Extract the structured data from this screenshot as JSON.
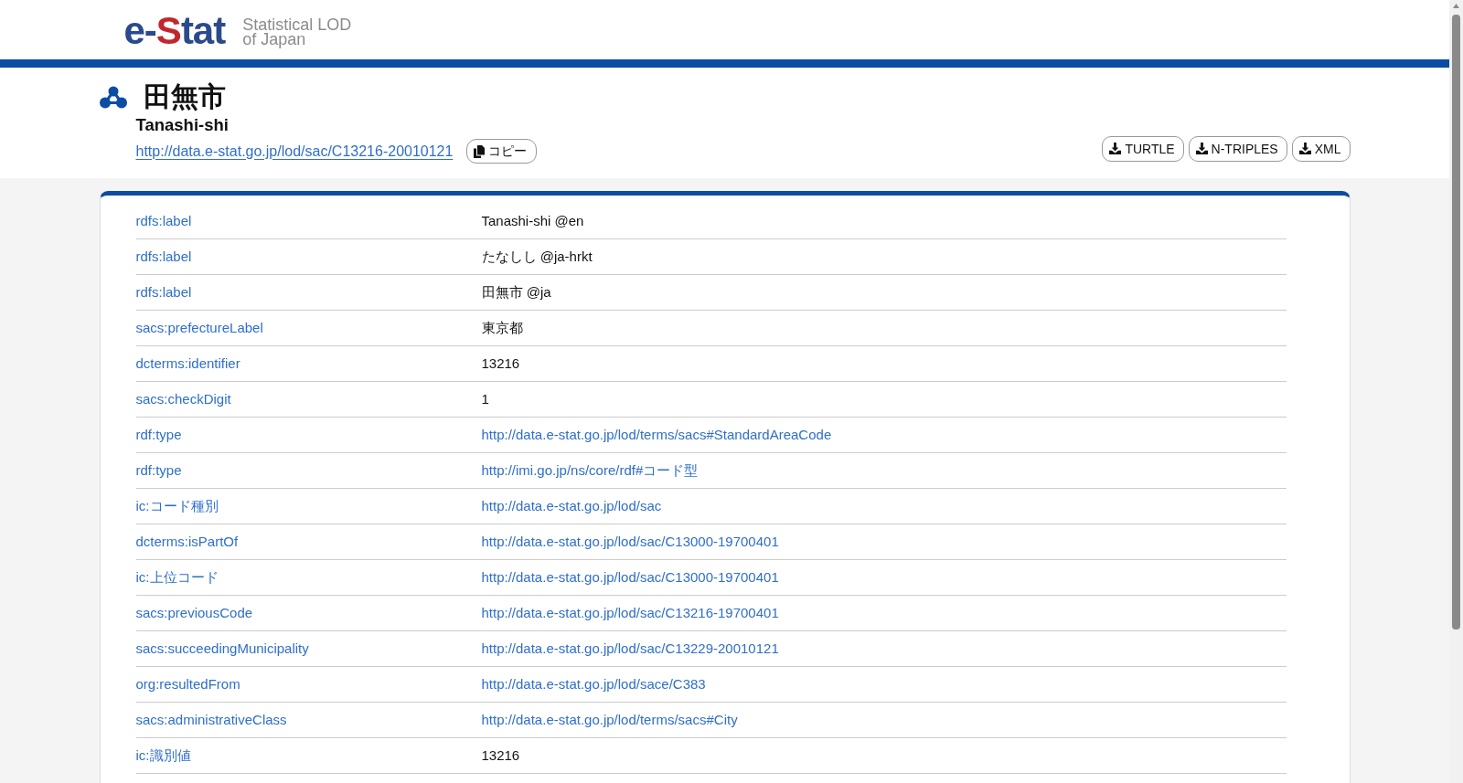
{
  "header": {
    "logo": {
      "parts": [
        {
          "text": "e-",
          "color": "#2b4a8b"
        },
        {
          "text": "S",
          "color": "#c1272d"
        },
        {
          "text": "tat",
          "color": "#2b4a8b"
        }
      ]
    },
    "tagline": [
      "Statistical LOD",
      "of Japan"
    ]
  },
  "resource": {
    "title": "田無市",
    "subtitle": "Tanashi-shi",
    "uri": "http://data.e-stat.go.jp/lod/sac/C13216-20010121",
    "copy_button": "コピー",
    "downloads": [
      "TURTLE",
      "N-TRIPLES",
      "XML"
    ]
  },
  "table": {
    "rows": [
      {
        "property": "rdfs:label",
        "value": "Tanashi-shi @en",
        "kind": "literal"
      },
      {
        "property": "rdfs:label",
        "value": "たなしし @ja-hrkt",
        "kind": "literal"
      },
      {
        "property": "rdfs:label",
        "value": "田無市 @ja",
        "kind": "literal"
      },
      {
        "property": "sacs:prefectureLabel",
        "value": "東京都",
        "kind": "literal"
      },
      {
        "property": "dcterms:identifier",
        "value": "13216",
        "kind": "literal"
      },
      {
        "property": "sacs:checkDigit",
        "value": "1",
        "kind": "literal"
      },
      {
        "property": "rdf:type",
        "value": "http://data.e-stat.go.jp/lod/terms/sacs#StandardAreaCode",
        "kind": "link"
      },
      {
        "property": "rdf:type",
        "value": "http://imi.go.jp/ns/core/rdf#コード型",
        "kind": "link"
      },
      {
        "property": "ic:コード種別",
        "value": "http://data.e-stat.go.jp/lod/sac",
        "kind": "link"
      },
      {
        "property": "dcterms:isPartOf",
        "value": "http://data.e-stat.go.jp/lod/sac/C13000-19700401",
        "kind": "link"
      },
      {
        "property": "ic:上位コード",
        "value": "http://data.e-stat.go.jp/lod/sac/C13000-19700401",
        "kind": "link"
      },
      {
        "property": "sacs:previousCode",
        "value": "http://data.e-stat.go.jp/lod/sac/C13216-19700401",
        "kind": "link"
      },
      {
        "property": "sacs:succeedingMunicipality",
        "value": "http://data.e-stat.go.jp/lod/sac/C13229-20010121",
        "kind": "link"
      },
      {
        "property": "org:resultedFrom",
        "value": "http://data.e-stat.go.jp/lod/sace/C383",
        "kind": "link"
      },
      {
        "property": "sacs:administrativeClass",
        "value": "http://data.e-stat.go.jp/lod/terms/sacs#City",
        "kind": "link"
      },
      {
        "property": "ic:識別値",
        "value": "13216",
        "kind": "literal"
      }
    ]
  }
}
